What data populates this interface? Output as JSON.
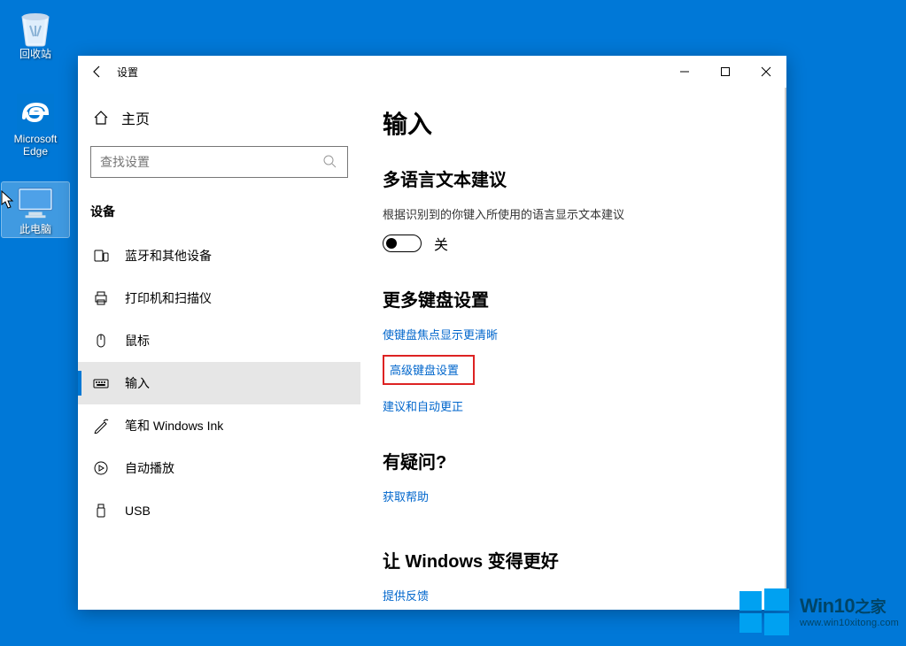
{
  "desktop": {
    "icons": [
      {
        "name": "recycle-bin",
        "label": "回收站"
      },
      {
        "name": "edge",
        "label": "Microsoft Edge"
      },
      {
        "name": "this-pc",
        "label": "此电脑"
      }
    ]
  },
  "window": {
    "title": "设置",
    "home_label": "主页",
    "search_placeholder": "查找设置",
    "section_label": "设备",
    "nav": [
      {
        "id": "bluetooth",
        "label": "蓝牙和其他设备"
      },
      {
        "id": "printers",
        "label": "打印机和扫描仪"
      },
      {
        "id": "mouse",
        "label": "鼠标"
      },
      {
        "id": "typing",
        "label": "输入"
      },
      {
        "id": "pen",
        "label": "笔和 Windows Ink"
      },
      {
        "id": "autoplay",
        "label": "自动播放"
      },
      {
        "id": "usb",
        "label": "USB"
      }
    ],
    "active_nav": "typing"
  },
  "content": {
    "heading": "输入",
    "section1": {
      "title": "多语言文本建议",
      "desc": "根据识别到的你键入所使用的语言显示文本建议",
      "toggle_state": "关"
    },
    "section2": {
      "title": "更多键盘设置",
      "links": [
        "使键盘焦点显示更清晰",
        "高级键盘设置",
        "建议和自动更正"
      ]
    },
    "section3": {
      "title": "有疑问?",
      "link": "获取帮助"
    },
    "section4": {
      "title": "让 Windows 变得更好",
      "link": "提供反馈"
    }
  },
  "watermark": {
    "title_main": "Win10",
    "title_suffix": "之家",
    "url": "www.win10xitong.com"
  }
}
